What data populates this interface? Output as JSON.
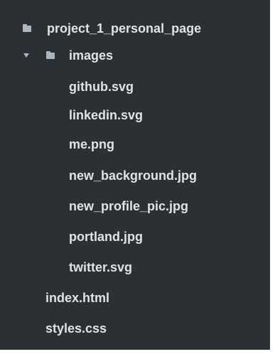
{
  "tree": {
    "root_folder": {
      "label": "project_1_personal_page",
      "icon": "folder-icon"
    },
    "images_folder": {
      "label": "images",
      "icon": "folder-icon",
      "expanded": true,
      "chevron": "chevron-down-icon"
    },
    "image_files": [
      {
        "label": "github.svg"
      },
      {
        "label": "linkedin.svg"
      },
      {
        "label": "me.png"
      },
      {
        "label": "new_background.jpg"
      },
      {
        "label": "new_profile_pic.jpg"
      },
      {
        "label": "portland.jpg"
      },
      {
        "label": "twitter.svg"
      }
    ],
    "root_files": [
      {
        "label": "index.html"
      },
      {
        "label": "styles.css"
      }
    ]
  },
  "colors": {
    "panel_background": "#2b3035",
    "text": "#dfe3e6",
    "icon": "#aeb6bd"
  }
}
